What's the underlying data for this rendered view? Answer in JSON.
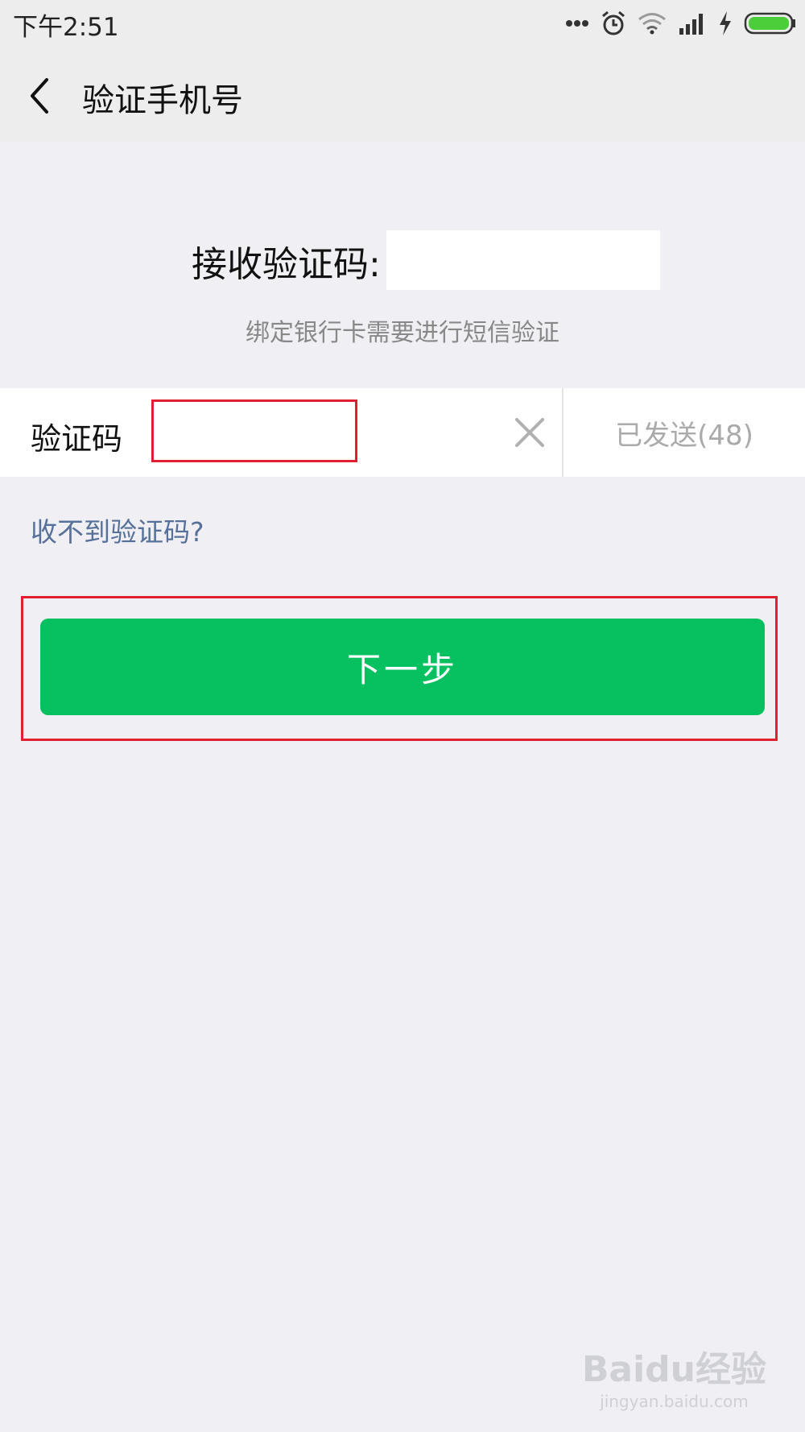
{
  "status_bar": {
    "time": "下午2:51",
    "icons": [
      "more-dots-icon",
      "alarm-icon",
      "wifi-icon",
      "signal-icon",
      "charging-icon",
      "battery-icon"
    ]
  },
  "nav": {
    "back_icon": "chevron-left-icon",
    "title": "验证手机号"
  },
  "receive": {
    "label": "接收验证码:"
  },
  "sms_hint": "绑定银行卡需要进行短信验证",
  "code_field": {
    "label": "验证码",
    "value": "",
    "resend_label": "已发送(48)"
  },
  "help_link": "收不到验证码?",
  "next_button": "下一步",
  "watermark": {
    "main": "Baidu经验",
    "sub": "jingyan.baidu.com"
  },
  "colors": {
    "primary": "#07c160",
    "link": "#57709a",
    "highlight": "#e02030",
    "battery": "#4ccd3a"
  }
}
